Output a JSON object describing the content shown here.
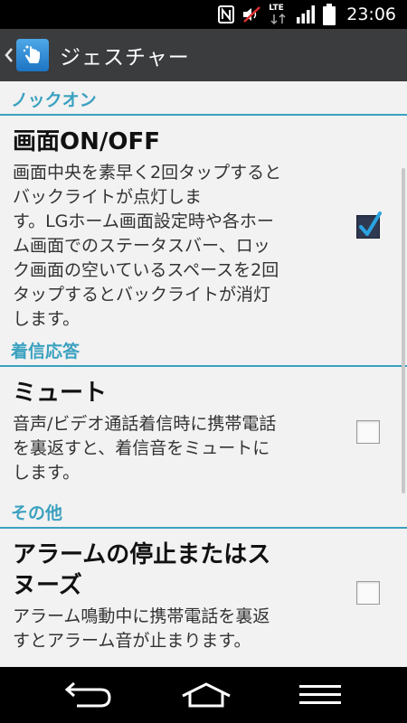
{
  "status_bar": {
    "time": "23:06",
    "icons": [
      "nfc-icon",
      "mute-icon",
      "lte-icon",
      "signal-icon",
      "battery-icon"
    ],
    "lte_label": "LTE"
  },
  "app_bar": {
    "title": "ジェスチャー",
    "icon": "gesture-hand-icon"
  },
  "sections": [
    {
      "header": "ノックオン",
      "item": {
        "title": "画面ON/OFF",
        "summary_lines": [
          "画面中央を素早く2回タップすると",
          "バックライトが点灯しま",
          "す。LGホーム画面設定時や各ホー",
          "ム画面でのステータスバー、ロッ",
          "ク画面の空いているスペースを2回",
          "タップするとバックライトが消灯",
          "します。"
        ],
        "checked": true
      }
    },
    {
      "header": "着信応答",
      "item": {
        "title": "ミュート",
        "summary_lines": [
          "音声/ビデオ通話着信時に携帯電話",
          "を裏返すと、着信音をミュートに",
          "します。"
        ],
        "checked": false
      }
    },
    {
      "header": "その他",
      "item": {
        "title_lines": [
          "アラームの停止またはス",
          "ヌーズ"
        ],
        "summary_lines": [
          "アラーム鳴動中に携帯電話を裏返",
          "すとアラーム音が止まります。"
        ],
        "checked": false
      }
    }
  ],
  "nav_bar": {
    "buttons": [
      "back-icon",
      "home-icon",
      "menu-icon"
    ]
  },
  "colors": {
    "accent": "#3ba1c0",
    "app_bar": "#3a3c3e",
    "background": "#f2f2f2",
    "checked_box": "#2f3a52",
    "checkmark": "#2aa4e0"
  }
}
